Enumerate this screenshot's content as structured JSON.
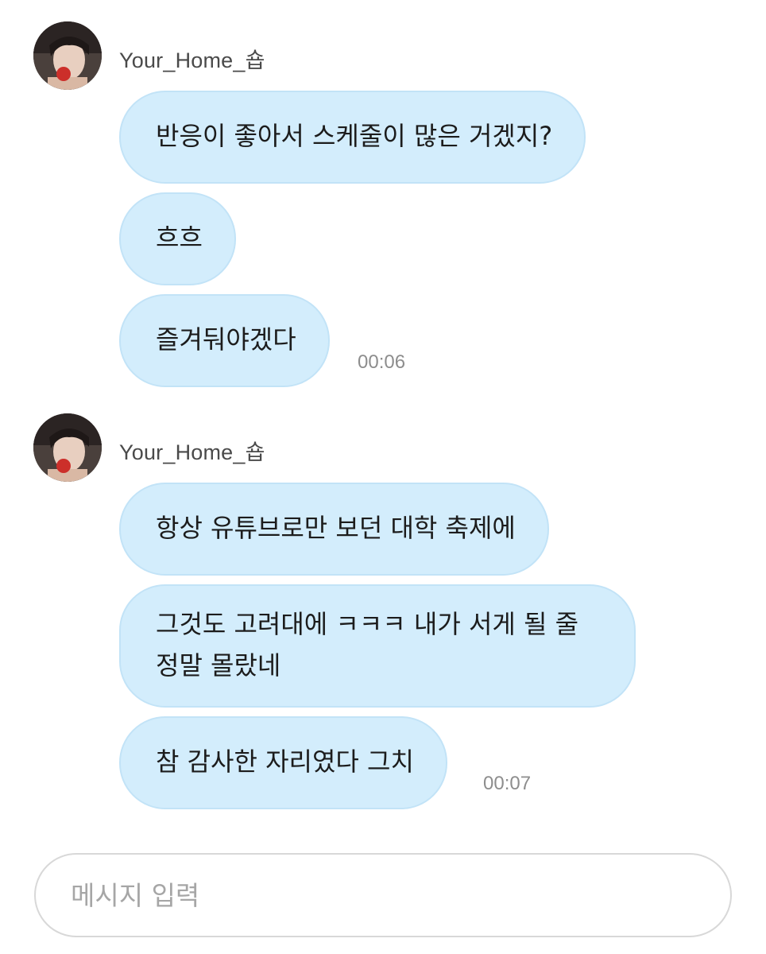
{
  "chat": {
    "groups": [
      {
        "sender": "Your_Home_숍",
        "messages": [
          "반응이 좋아서 스케줄이 많은 거겠지?",
          "흐흐",
          "즐겨둬야겠다"
        ],
        "time": "00:06"
      },
      {
        "sender": "Your_Home_숍",
        "messages": [
          "항상 유튜브로만 보던 대학 축제에",
          "그것도 고려대에 ㅋㅋㅋ 내가 서게 될 줄 정말 몰랐네",
          "참 감사한 자리였다 그치"
        ],
        "time": "00:07"
      }
    ]
  },
  "input": {
    "placeholder": "메시지 입력"
  },
  "colors": {
    "bubble": "#d3edfc",
    "bubble_border": "#c2e3f7",
    "timestamp": "#8d8d8d"
  },
  "icons": [
    "avatar"
  ]
}
